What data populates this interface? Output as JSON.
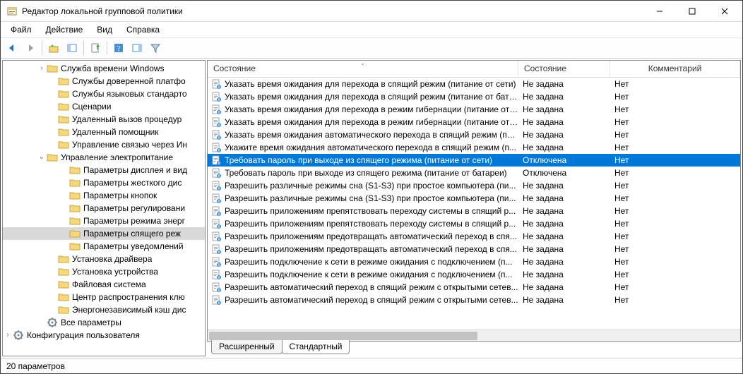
{
  "window": {
    "title": "Редактор локальной групповой политики"
  },
  "menu": [
    "Файл",
    "Действие",
    "Вид",
    "Справка"
  ],
  "toolbar_icons": [
    "back",
    "forward",
    "up",
    "show-hide-tree",
    "export-list",
    "help",
    "show-hide-actions",
    "filter"
  ],
  "tree": [
    {
      "indent": 3,
      "caret": "closed",
      "type": "folder",
      "label": "Служба времени Windows"
    },
    {
      "indent": 4,
      "caret": "",
      "type": "folder",
      "label": "Службы доверенной платфо"
    },
    {
      "indent": 4,
      "caret": "",
      "type": "folder",
      "label": "Службы языковых стандарто"
    },
    {
      "indent": 4,
      "caret": "",
      "type": "folder",
      "label": "Сценарии"
    },
    {
      "indent": 4,
      "caret": "",
      "type": "folder",
      "label": "Удаленный вызов процедур"
    },
    {
      "indent": 4,
      "caret": "",
      "type": "folder",
      "label": "Удаленный помощник"
    },
    {
      "indent": 4,
      "caret": "",
      "type": "folder",
      "label": "Управление связью через Ин"
    },
    {
      "indent": 3,
      "caret": "open",
      "type": "folder",
      "label": "Управление электропитание"
    },
    {
      "indent": 5,
      "caret": "",
      "type": "folder",
      "label": "Параметры дисплея и вид"
    },
    {
      "indent": 5,
      "caret": "",
      "type": "folder",
      "label": "Параметры жесткого дис"
    },
    {
      "indent": 5,
      "caret": "",
      "type": "folder",
      "label": "Параметры кнопок"
    },
    {
      "indent": 5,
      "caret": "",
      "type": "folder",
      "label": "Параметры регулировани"
    },
    {
      "indent": 5,
      "caret": "",
      "type": "folder",
      "label": "Параметры режима энерг"
    },
    {
      "indent": 5,
      "caret": "",
      "type": "folder",
      "label": "Параметры спящего реж",
      "selected": true
    },
    {
      "indent": 5,
      "caret": "",
      "type": "folder",
      "label": "Параметры уведомлений"
    },
    {
      "indent": 4,
      "caret": "",
      "type": "folder",
      "label": "Установка драйвера"
    },
    {
      "indent": 4,
      "caret": "",
      "type": "folder",
      "label": "Установка устройства"
    },
    {
      "indent": 4,
      "caret": "",
      "type": "folder",
      "label": "Файловая система"
    },
    {
      "indent": 4,
      "caret": "",
      "type": "folder",
      "label": "Центр распространения клю"
    },
    {
      "indent": 4,
      "caret": "",
      "type": "folder",
      "label": "Энергонезависимый кэш дис"
    },
    {
      "indent": 3,
      "caret": "",
      "type": "cfg",
      "label": "Все параметры"
    },
    {
      "indent": 0,
      "caret": "closed",
      "type": "cfg",
      "label": "Конфигурация пользователя"
    }
  ],
  "grid": {
    "columns": {
      "name": "Состояние",
      "state": "Состояние",
      "comment": "Комментарий"
    },
    "rows": [
      {
        "name": "Указать время ожидания для перехода в спящий режим (питание от сети)",
        "state": "Не задана",
        "comment": "Нет"
      },
      {
        "name": "Указать время ожидания для перехода в спящий режим (питание от бата...",
        "state": "Не задана",
        "comment": "Нет"
      },
      {
        "name": "Указать время ожидания для перехода в режим гибернации (питание от ...",
        "state": "Не задана",
        "comment": "Нет"
      },
      {
        "name": "Указать время ожидания для перехода в режим гибернации (питание от ...",
        "state": "Не задана",
        "comment": "Нет"
      },
      {
        "name": "Указать время ожидания автоматического перехода в спящий режим (пи...",
        "state": "Не задана",
        "comment": "Нет"
      },
      {
        "name": "Укажите время ожидания автоматического перехода в спящий режим (п...",
        "state": "Не задана",
        "comment": "Нет"
      },
      {
        "name": "Требовать пароль при выходе из спящего режима (питание от сети)",
        "state": "Отключена",
        "comment": "Нет",
        "selected": true
      },
      {
        "name": "Требовать пароль при выходе из спящего режима (питание от батареи)",
        "state": "Отключена",
        "comment": "Нет"
      },
      {
        "name": "Разрешить различные режимы сна (S1-S3) при простое компьютера (пи...",
        "state": "Не задана",
        "comment": "Нет"
      },
      {
        "name": "Разрешить различные режимы сна (S1-S3) при простое компьютера (пи...",
        "state": "Не задана",
        "comment": "Нет"
      },
      {
        "name": "Разрешить приложениям препятствовать переходу системы в спящий р...",
        "state": "Не задана",
        "comment": "Нет"
      },
      {
        "name": "Разрешить приложениям препятствовать переходу системы в спящий р...",
        "state": "Не задана",
        "comment": "Нет"
      },
      {
        "name": "Разрешить приложениям предотвращать автоматический переход в спя...",
        "state": "Не задана",
        "comment": "Нет"
      },
      {
        "name": "Разрешить приложениям предотвращать автоматический переход в спя...",
        "state": "Не задана",
        "comment": "Нет"
      },
      {
        "name": "Разрешить подключение к сети в режиме ожидания с подключением (п...",
        "state": "Не задана",
        "comment": "Нет"
      },
      {
        "name": "Разрешить подключение к сети в режиме ожидания с подключением (п...",
        "state": "Не задана",
        "comment": "Нет"
      },
      {
        "name": "Разрешить автоматический переход в спящий режим с открытыми сетев...",
        "state": "Не задана",
        "comment": "Нет"
      },
      {
        "name": "Разрешить автоматический переход в спящий режим с открытыми сетев...",
        "state": "Не задана",
        "comment": "Нет"
      }
    ]
  },
  "bottom_tabs": {
    "extended": "Расширенный",
    "standard": "Стандартный"
  },
  "status": "20 параметров"
}
